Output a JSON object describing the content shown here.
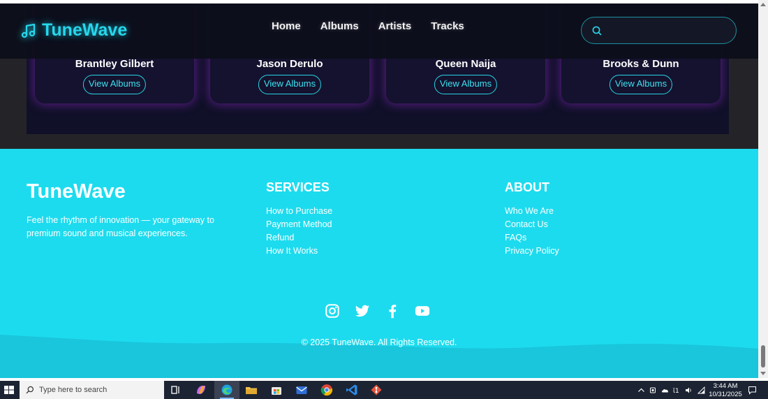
{
  "navbar": {
    "brand_name": "TuneWave",
    "links": [
      "Home",
      "Albums",
      "Artists",
      "Tracks"
    ],
    "search_value": ""
  },
  "artists": [
    {
      "name": "Brantley Gilbert",
      "button": "View Albums"
    },
    {
      "name": "Jason Derulo",
      "button": "View Albums"
    },
    {
      "name": "Queen Naija",
      "button": "View Albums"
    },
    {
      "name": "Brooks & Dunn",
      "button": "View Albums"
    }
  ],
  "footer": {
    "brand_title": "TuneWave",
    "tagline": "Feel the rhythm of innovation — your gateway to premium sound and musical experiences.",
    "services": {
      "heading": "SERVICES",
      "links": [
        "How to Purchase",
        "Payment Method",
        "Refund",
        "How It Works"
      ]
    },
    "about": {
      "heading": "ABOUT",
      "links": [
        "Who We Are",
        "Contact Us",
        "FAQs",
        "Privacy Policy"
      ]
    },
    "socials": [
      "instagram-icon",
      "twitter-icon",
      "facebook-icon",
      "youtube-icon"
    ],
    "copyright": "© 2025 TuneWave. All Rights Reserved."
  },
  "colors": {
    "accent": "#1ddbee",
    "navbar_bg": "#0c0e1a",
    "card_glow": "#8c28c8"
  },
  "taskbar": {
    "search_placeholder": "Type here to search",
    "time": "3:44 AM",
    "date": "10/31/2025",
    "apps": [
      "task-view-icon",
      "copilot-icon",
      "edge-icon",
      "file-explorer-icon",
      "store-icon",
      "mail-icon",
      "chrome-icon",
      "vscode-icon",
      "git-icon"
    ]
  }
}
